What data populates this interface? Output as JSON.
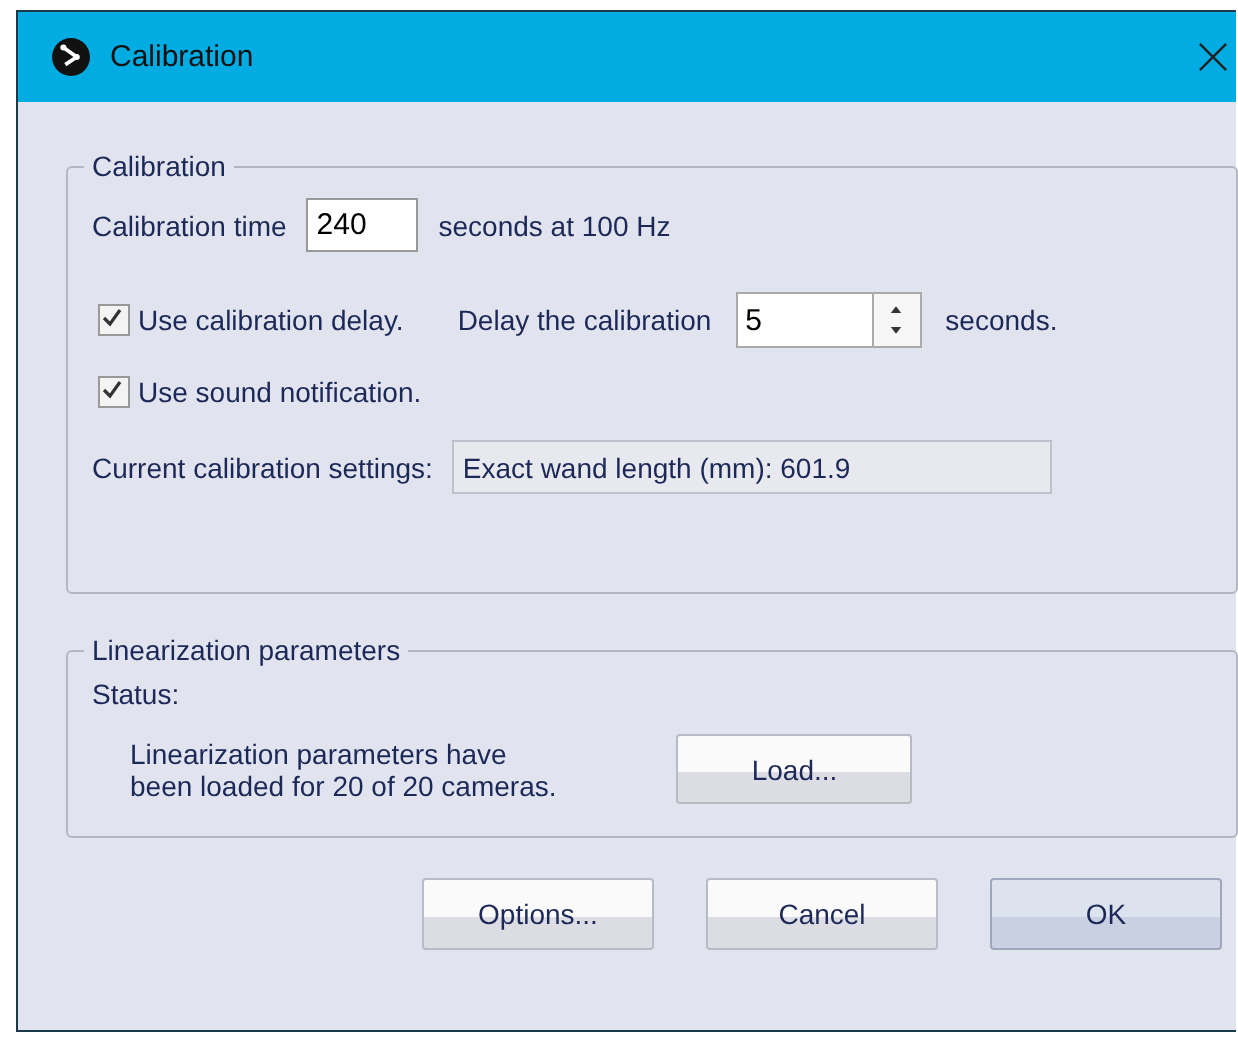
{
  "window": {
    "title": "Calibration"
  },
  "calibration": {
    "legend": "Calibration",
    "time_label": "Calibration time",
    "time_value": "240",
    "time_suffix": "seconds at  100 Hz",
    "delay_checkbox": {
      "label": "Use calibration delay.",
      "checked": true
    },
    "delay_label": "Delay the calibration",
    "delay_value": "5",
    "delay_suffix": "seconds.",
    "sound_checkbox": {
      "label": "Use sound notification.",
      "checked": true
    },
    "settings_label": "Current calibration settings:",
    "settings_value": "Exact wand length (mm): 601.9"
  },
  "linearization": {
    "legend": "Linearization parameters",
    "status_label": "Status:",
    "status_text": [
      "Linearization parameters have",
      "been loaded for 20 of 20 cameras."
    ],
    "load_button": "Load..."
  },
  "buttons": [
    {
      "label": "Options...",
      "default": false
    },
    {
      "label": "Cancel",
      "default": false
    },
    {
      "label": "OK",
      "default": true
    }
  ]
}
